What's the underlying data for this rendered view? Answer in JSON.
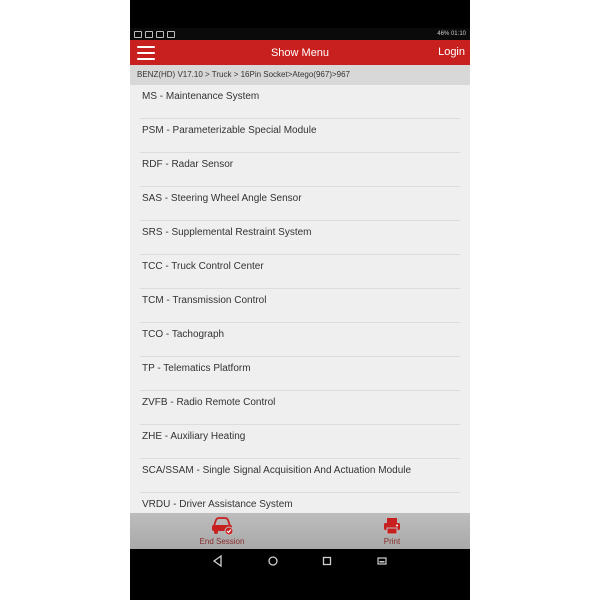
{
  "status_bar": {
    "right_text": "46% 01:10"
  },
  "appbar": {
    "title": "Show Menu",
    "login_label": "Login"
  },
  "breadcrumb": {
    "text": "BENZ(HD) V17.10 > Truck > 16Pin Socket>Atego(967)>967"
  },
  "menu_items": [
    "MS - Maintenance System",
    "PSM - Parameterizable Special Module",
    "RDF - Radar Sensor",
    "SAS - Steering Wheel Angle Sensor",
    "SRS - Supplemental Restraint System",
    "TCC - Truck Control Center",
    "TCM - Transmission Control",
    "TCO - Tachograph",
    "TP - Telematics Platform",
    "ZVFB - Radio Remote Control",
    "ZHE - Auxiliary Heating",
    "SCA/SSAM - Single Signal Acquisition And Actuation Module",
    "VRDU - Driver Assistance System"
  ],
  "bottom_bar": {
    "end_session_label": "End Session",
    "print_label": "Print"
  },
  "icons": {
    "menu": "hamburger-icon",
    "end_session": "car-check-icon",
    "print": "printer-icon",
    "back": "back-triangle-icon",
    "home": "home-circle-icon",
    "recents": "recents-square-icon",
    "keyboard": "keyboard-icon"
  },
  "colors": {
    "accent": "#c8201f",
    "list_bg": "#efefef",
    "breadcrumb_bg": "#d8d8d8"
  }
}
